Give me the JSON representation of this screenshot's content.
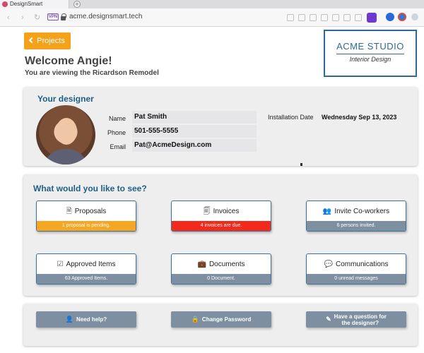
{
  "browser": {
    "tab_title": "DesignSmart",
    "new_tab": "+",
    "url": "acme.designsmart.tech",
    "vpn_label": "VPN",
    "nav_back": "‹",
    "nav_forward": "›",
    "nav_reload": "↻"
  },
  "header": {
    "projects_label": "Projects",
    "welcome": "Welcome Angie!",
    "viewing": "You are viewing the Ricardson Remodel",
    "logo_main": "ACME STUDIO",
    "logo_sub": "Interior Design"
  },
  "designer": {
    "title": "Your designer",
    "name_label": "Name",
    "name": "Pat Smith",
    "phone_label": "Phone",
    "phone": "501-555-5555",
    "email_label": "Email",
    "email": "Pat@AcmeDesign.com",
    "install_label": "Installation Date",
    "install_date": "Wednesday Sep 13, 2023"
  },
  "options": {
    "title": "What would you like to see?",
    "tiles": [
      {
        "label": "Proposals",
        "icon": "document-icon",
        "status": "1 proposal is pending.",
        "status_color": "#f5a623"
      },
      {
        "label": "Invoices",
        "icon": "invoice-icon",
        "status": "4 invoices are due.",
        "status_color": "#f2291b"
      },
      {
        "label": "Invite Co-workers",
        "icon": "users-icon",
        "status": "6 persons invited.",
        "status_color": "#7d8fa1"
      },
      {
        "label": "Approved Items",
        "icon": "checklist-icon",
        "status": "63 Approved Items.",
        "status_color": "#7d8fa1"
      },
      {
        "label": "Documents",
        "icon": "briefcase-icon",
        "status": "0 Document.",
        "status_color": "#7d8fa1"
      },
      {
        "label": "Communications",
        "icon": "chat-icon",
        "status": "0 unread messages",
        "status_color": "#7d8fa1"
      }
    ]
  },
  "help": {
    "need_help": "Need help?",
    "change_password": "Change Password",
    "question_line1": "Have a question for",
    "question_line2": "the designer?"
  },
  "colors": {
    "accent_orange": "#f4a21a",
    "brand_blue": "#1f5f85",
    "button_gray": "#7d8fa1"
  }
}
